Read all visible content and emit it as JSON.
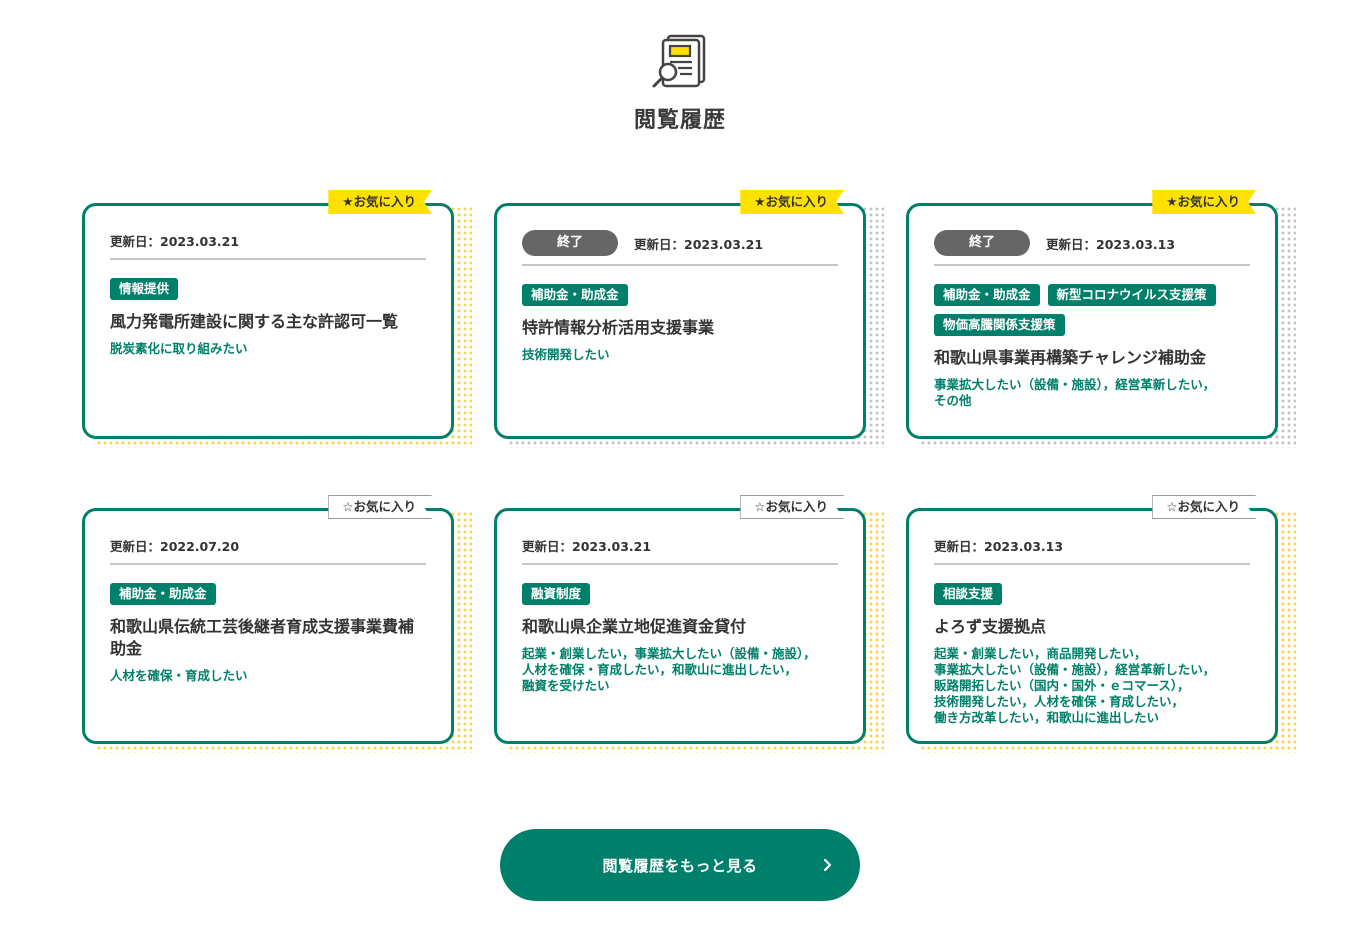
{
  "page": {
    "title": "閲覧履歴",
    "icon": "document-search-icon"
  },
  "colors": {
    "brand_green": "#00806a",
    "favorite_yellow": "#ffe100",
    "status_gray": "#666666",
    "dots_yellow": "#ffd24d",
    "dots_gray": "#c4c4c4"
  },
  "cards": [
    {
      "favorite": {
        "active": true,
        "label": "★お気に入り"
      },
      "status": "",
      "updated": "更新日：2023.03.21",
      "tags": [
        "情報提供"
      ],
      "title": "風力発電所建設に関する主な許認可一覧",
      "purpose": "脱炭素化に取り組みたい"
    },
    {
      "favorite": {
        "active": true,
        "label": "★お気に入り"
      },
      "status": "終了",
      "updated": "更新日：2023.03.21",
      "tags": [
        "補助金・助成金"
      ],
      "title": "特許情報分析活用支援事業",
      "purpose": "技術開発したい"
    },
    {
      "favorite": {
        "active": true,
        "label": "★お気に入り"
      },
      "status": "終了",
      "updated": "更新日：2023.03.13",
      "tags": [
        "補助金・助成金",
        "新型コロナウイルス支援策",
        "物価高騰関係支援策"
      ],
      "title": "和歌山県事業再構築チャレンジ補助金",
      "purpose": "事業拡大したい（設備・施設），経営革新したい，\nその他"
    },
    {
      "favorite": {
        "active": false,
        "label": "☆お気に入り"
      },
      "status": "",
      "updated": "更新日：2022.07.20",
      "tags": [
        "補助金・助成金"
      ],
      "title": "和歌山県伝統工芸後継者育成支援事業費補\n助金",
      "purpose": "人材を確保・育成したい"
    },
    {
      "favorite": {
        "active": false,
        "label": "☆お気に入り"
      },
      "status": "",
      "updated": "更新日：2023.03.21",
      "tags": [
        "融資制度"
      ],
      "title": "和歌山県企業立地促進資金貸付",
      "purpose": "起業・創業したい，事業拡大したい（設備・施設），\n人材を確保・育成したい，和歌山に進出したい，\n融資を受けたい"
    },
    {
      "favorite": {
        "active": false,
        "label": "☆お気に入り"
      },
      "status": "",
      "updated": "更新日：2023.03.13",
      "tags": [
        "相談支援"
      ],
      "title": "よろず支援拠点",
      "purpose": "起業・創業したい，商品開発したい，\n事業拡大したい（設備・施設），経営革新したい，\n販路開拓したい（国内・国外・ｅコマース），\n技術開発したい，人材を確保・育成したい，\n働き方改革したい，和歌山に進出したい"
    }
  ],
  "more_button": {
    "label": "閲覧履歴をもっと見る",
    "icon": "chevron-right-icon"
  }
}
